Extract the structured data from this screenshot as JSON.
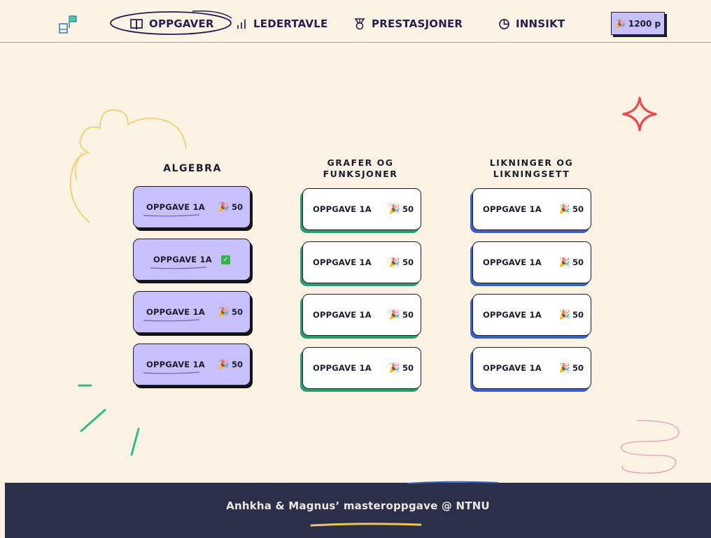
{
  "header": {
    "nav": [
      {
        "label": "OPPGAVER",
        "icon": "book-icon",
        "active": true
      },
      {
        "label": "LEDERTAVLE",
        "icon": "bar-chart-icon",
        "active": false
      },
      {
        "label": "PRESTASJONER",
        "icon": "medal-icon",
        "active": false
      },
      {
        "label": "INNSIKT",
        "icon": "pie-chart-icon",
        "active": false
      }
    ],
    "points": {
      "emoji": "🎉",
      "value": "1200 p"
    }
  },
  "columns": [
    {
      "title": "ALGEBRA",
      "tasks": [
        {
          "label": "OPPGAVE 1A",
          "emoji": "🎉",
          "points": "50",
          "completed": false
        },
        {
          "label": "OPPGAVE 1A",
          "emoji": "✅",
          "points": "",
          "completed": true
        },
        {
          "label": "OPPGAVE 1A",
          "emoji": "🎉",
          "points": "50",
          "completed": false
        },
        {
          "label": "OPPGAVE 1A",
          "emoji": "🎉",
          "points": "50",
          "completed": false
        }
      ]
    },
    {
      "title_lines": [
        "GRAFER OG",
        "FUNKSJONER"
      ],
      "tasks": [
        {
          "label": "OPPGAVE 1A",
          "emoji": "🎉",
          "points": "50"
        },
        {
          "label": "OPPGAVE 1A",
          "emoji": "🎉",
          "points": "50"
        },
        {
          "label": "OPPGAVE 1A",
          "emoji": "🎉",
          "points": "50"
        },
        {
          "label": "OPPGAVE 1A",
          "emoji": "🎉",
          "points": "50"
        }
      ]
    },
    {
      "title_lines": [
        "LIKNINGER OG",
        "LIKNINGSETT"
      ],
      "tasks": [
        {
          "label": "OPPGAVE 1A",
          "emoji": "🎉",
          "points": "50"
        },
        {
          "label": "OPPGAVE 1A",
          "emoji": "🎉",
          "points": "50"
        },
        {
          "label": "OPPGAVE 1A",
          "emoji": "🎉",
          "points": "50"
        },
        {
          "label": "OPPGAVE 1A",
          "emoji": "🎉",
          "points": "50"
        }
      ]
    }
  ],
  "footer": {
    "text": "Anhkha & Magnus’ masteroppgave @ NTNU"
  },
  "colors": {
    "background": "#fdf3e4",
    "nav_text": "#241f4e",
    "algebra_card": "#c7c0fa",
    "grafer_accent": "#2a9c6d",
    "likninger_accent": "#3d5fc4",
    "footer_bg": "#2b2f49",
    "footer_underline": "#f2c94c",
    "sparkle_red": "#f2474b"
  }
}
